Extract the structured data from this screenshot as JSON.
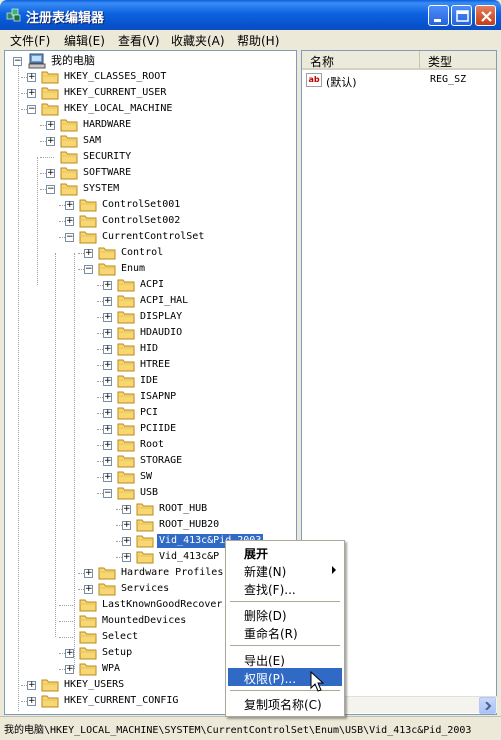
{
  "window": {
    "title": "注册表编辑器"
  },
  "menubar": [
    {
      "label": "文件(F)"
    },
    {
      "label": "编辑(E)"
    },
    {
      "label": "查看(V)"
    },
    {
      "label": "收藏夹(A)"
    },
    {
      "label": "帮助(H)"
    }
  ],
  "tree": {
    "root_label": "我的电脑",
    "nodes": [
      {
        "label": "HKEY_CLASSES_ROOT"
      },
      {
        "label": "HKEY_CURRENT_USER"
      },
      {
        "label": "HKEY_LOCAL_MACHINE"
      },
      {
        "label": "HARDWARE"
      },
      {
        "label": "SAM"
      },
      {
        "label": "SECURITY"
      },
      {
        "label": "SOFTWARE"
      },
      {
        "label": "SYSTEM"
      },
      {
        "label": "ControlSet001"
      },
      {
        "label": "ControlSet002"
      },
      {
        "label": "CurrentControlSet"
      },
      {
        "label": "Control"
      },
      {
        "label": "Enum"
      },
      {
        "label": "ACPI"
      },
      {
        "label": "ACPI_HAL"
      },
      {
        "label": "DISPLAY"
      },
      {
        "label": "HDAUDIO"
      },
      {
        "label": "HID"
      },
      {
        "label": "HTREE"
      },
      {
        "label": "IDE"
      },
      {
        "label": "ISAPNP"
      },
      {
        "label": "PCI"
      },
      {
        "label": "PCIIDE"
      },
      {
        "label": "Root"
      },
      {
        "label": "STORAGE"
      },
      {
        "label": "SW"
      },
      {
        "label": "USB"
      },
      {
        "label": "ROOT_HUB"
      },
      {
        "label": "ROOT_HUB20"
      },
      {
        "label": "Vid_413c&Pid_2003"
      },
      {
        "label": "Vid_413c&P"
      },
      {
        "label": "Hardware Profiles"
      },
      {
        "label": "Services"
      },
      {
        "label": "LastKnownGoodRecover"
      },
      {
        "label": "MountedDevices"
      },
      {
        "label": "Select"
      },
      {
        "label": "Setup"
      },
      {
        "label": "WPA"
      },
      {
        "label": "HKEY_USERS"
      },
      {
        "label": "HKEY_CURRENT_CONFIG"
      }
    ]
  },
  "list": {
    "columns": [
      "名称",
      "类型"
    ],
    "rows": [
      {
        "icon": "ab",
        "name": "(默认)",
        "type": "REG_SZ"
      }
    ]
  },
  "context_menu": {
    "items": [
      "展开",
      "新建(N)",
      "查找(F)...",
      "删除(D)",
      "重命名(R)",
      "导出(E)",
      "权限(P)...",
      "复制项名称(C)"
    ]
  },
  "statusbar": {
    "path": "我的电脑\\HKEY_LOCAL_MACHINE\\SYSTEM\\CurrentControlSet\\Enum\\USB\\Vid_413c&Pid_2003"
  },
  "colors": {
    "title_bar": "#0A5EDB",
    "selection": "#316AC5",
    "window_bg": "#ECE9D8"
  }
}
